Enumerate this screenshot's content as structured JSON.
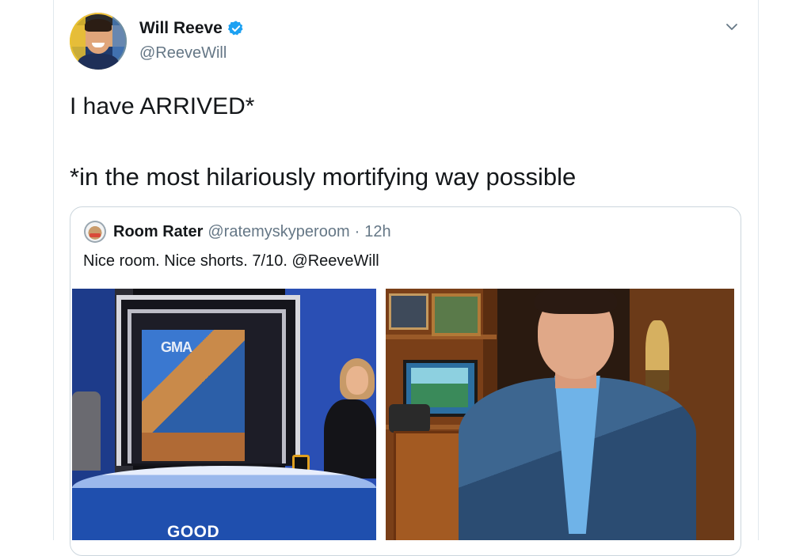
{
  "tweet": {
    "author": {
      "display_name": "Will Reeve",
      "handle": "@ReeveWill",
      "verified": true
    },
    "line1": "I have ARRIVED*",
    "line2": "*in the most hilariously mortifying way possible",
    "menu_icon": "chevron-down-icon"
  },
  "quote": {
    "author_name": "Room Rater",
    "author_handle": "@ratemyskyperoom",
    "separator": "·",
    "time": "12h",
    "text": "Nice room. Nice shorts. 7/10. @ReeveWill",
    "photos": {
      "left_overlay_top": "GMA",
      "left_overlay_bottom": "GOOD"
    }
  },
  "colors": {
    "verified_blue": "#1da1f2",
    "secondary_text": "#657786",
    "primary_text": "#14171a",
    "border": "#ccd6dd"
  }
}
